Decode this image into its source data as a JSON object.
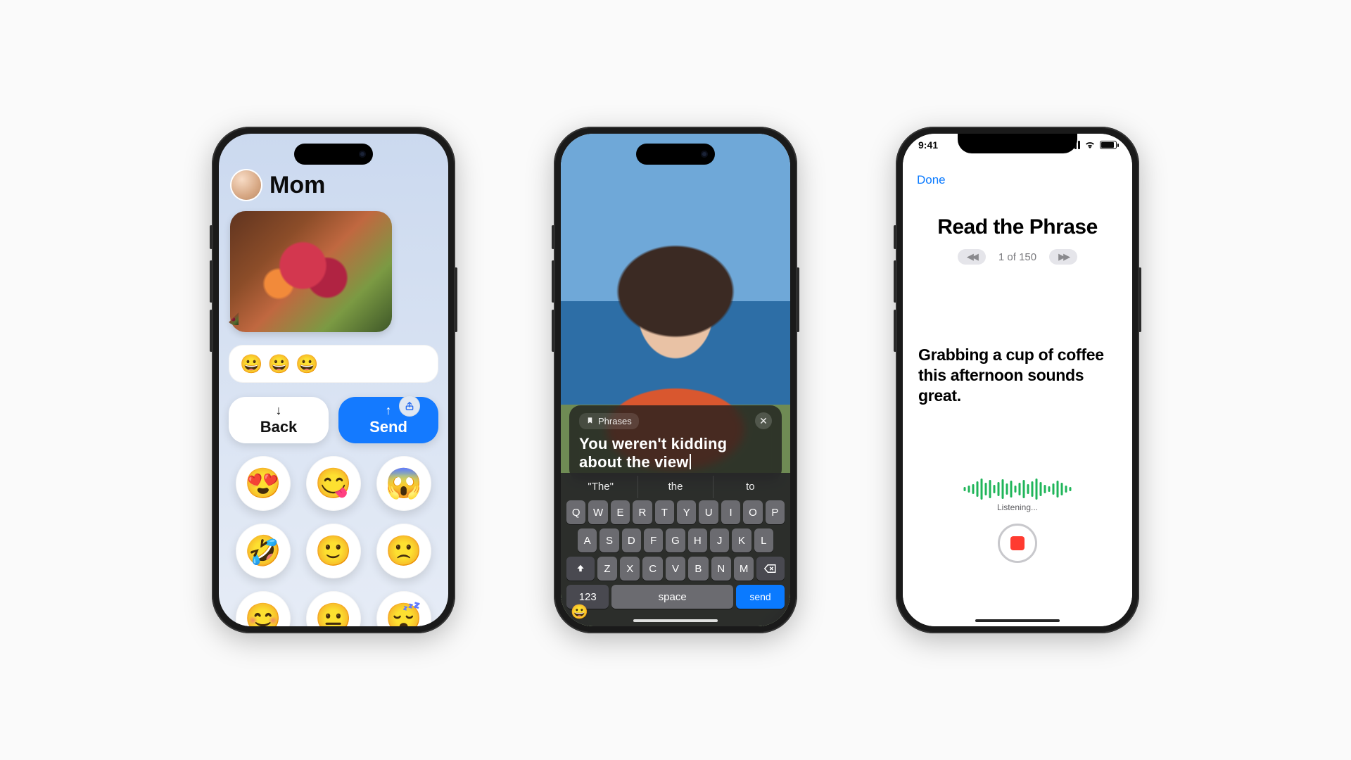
{
  "phone1": {
    "contact_name": "Mom",
    "input_value": "😀 😀 😀",
    "back_label": "Back",
    "send_label": "Send",
    "emoji_options": [
      "😍",
      "😋",
      "😱",
      "🤣",
      "🙂",
      "🙁",
      "😊",
      "😐",
      "😴"
    ]
  },
  "phone2": {
    "phrases_label": "Phrases",
    "typed_text": "You weren't kidding about the view",
    "suggestions": [
      "\"The\"",
      "the",
      "to"
    ],
    "row1": [
      "Q",
      "W",
      "E",
      "R",
      "T",
      "Y",
      "U",
      "I",
      "O",
      "P"
    ],
    "row2": [
      "A",
      "S",
      "D",
      "F",
      "G",
      "H",
      "J",
      "K",
      "L"
    ],
    "row3": [
      "Z",
      "X",
      "C",
      "V",
      "B",
      "N",
      "M"
    ],
    "key_123": "123",
    "key_space": "space",
    "key_send": "send"
  },
  "phone3": {
    "time": "9:41",
    "done": "Done",
    "title": "Read the Phrase",
    "pager": "1 of 150",
    "phrase": "Grabbing a cup of coffee this afternoon sounds great.",
    "listening": "Listening..."
  }
}
